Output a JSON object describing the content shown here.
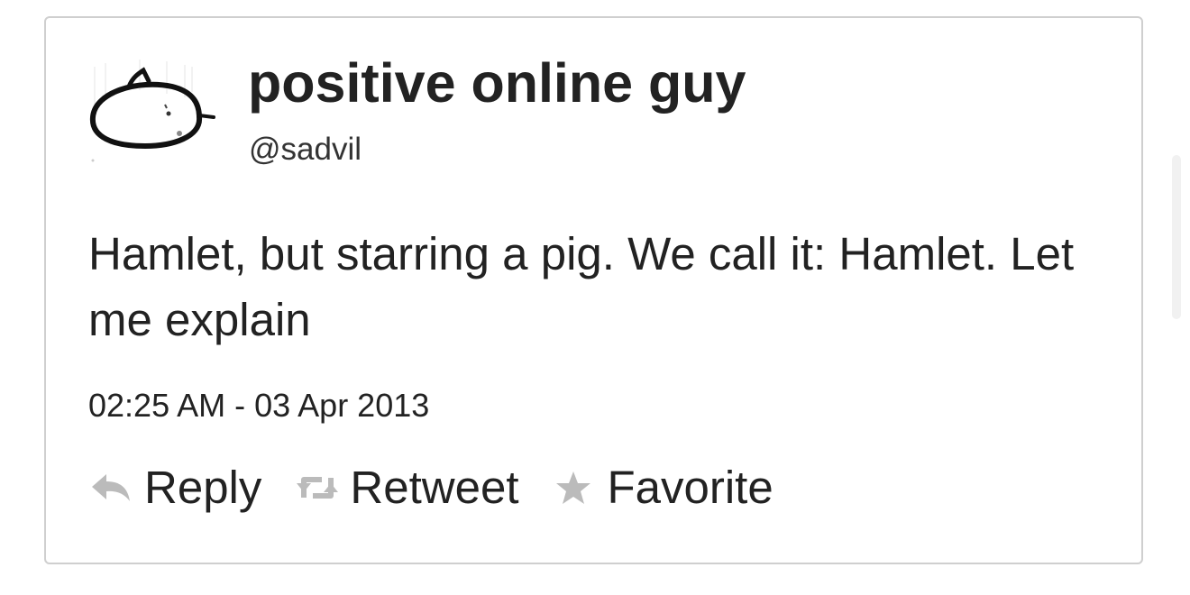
{
  "author": {
    "display_name": "positive online guy",
    "handle": "@sadvil"
  },
  "tweet": {
    "text": "Hamlet, but starring a pig. We call it: Hamlet. Let me explain",
    "timestamp": "02:25 AM - 03 Apr 2013"
  },
  "actions": {
    "reply_label": "Reply",
    "retweet_label": "Retweet",
    "favorite_label": "Favorite"
  },
  "icons": {
    "avatar": "pig-doodle-avatar",
    "reply": "reply-arrow-icon",
    "retweet": "retweet-icon",
    "favorite": "star-icon"
  },
  "colors": {
    "text": "#222222",
    "icon": "#bbbbbb",
    "border": "#cfcfcf"
  }
}
